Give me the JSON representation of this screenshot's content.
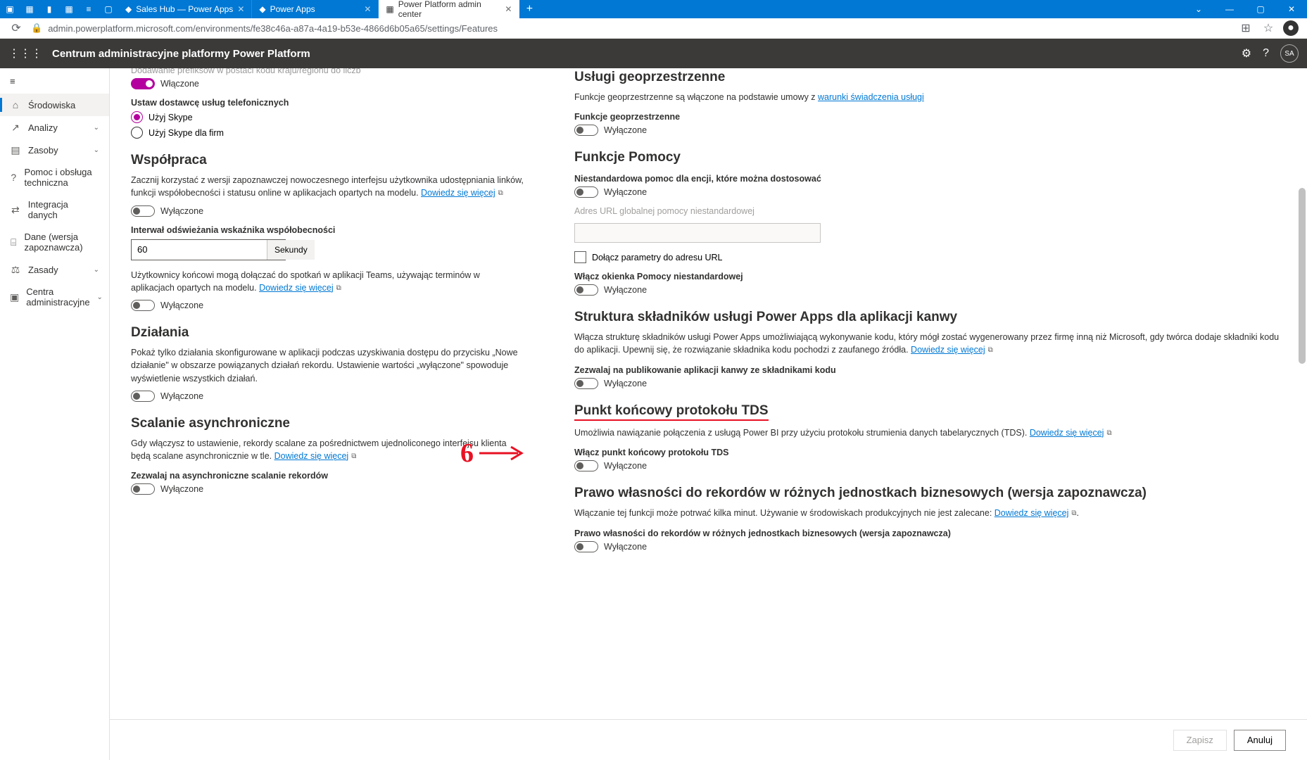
{
  "taskbar_apps": [
    "teams",
    "grid",
    "charts",
    "grid2",
    "list",
    "square"
  ],
  "browser": {
    "tabs": [
      {
        "icon": "◆",
        "label": "Sales Hub — Power Apps",
        "active": false
      },
      {
        "icon": "◆",
        "label": "Power Apps",
        "active": false
      },
      {
        "icon": "▦",
        "label": "Power Platform admin center",
        "active": true
      }
    ],
    "url": "admin.powerplatform.microsoft.com/environments/fe38c46a-a87a-4a19-b53e-4866d6b05a65/settings/Features"
  },
  "appbar": {
    "title": "Centrum administracyjne platformy Power Platform",
    "avatar": "SA"
  },
  "sidebar": {
    "items": [
      {
        "icon": "⌂",
        "label": "Środowiska",
        "active": true,
        "chev": false
      },
      {
        "icon": "↗",
        "label": "Analizy",
        "chev": true
      },
      {
        "icon": "▤",
        "label": "Zasoby",
        "chev": true
      },
      {
        "icon": "?",
        "label": "Pomoc i obsługa techniczna",
        "chev": false
      },
      {
        "icon": "⇄",
        "label": "Integracja danych",
        "chev": false
      },
      {
        "icon": "⌸",
        "label": "Dane (wersja zapoznawcza)",
        "chev": false
      },
      {
        "icon": "⚖",
        "label": "Zasady",
        "chev": true
      },
      {
        "icon": "▣",
        "label": "Centra administracyjne",
        "chev": true
      }
    ]
  },
  "left": {
    "truncated": "Dodawanie prefiksów w postaci kodu kraju/regionu do liczb",
    "enabled": "Włączone",
    "disabled": "Wyłączone",
    "telephony_lbl": "Ustaw dostawcę usług telefonicznych",
    "radio_skype": "Użyj Skype",
    "radio_skype_biz": "Użyj Skype dla firm",
    "collab_h": "Współpraca",
    "collab_desc": "Zacznij korzystać z wersji zapoznawczej nowoczesnego interfejsu użytkownika udostępniania linków, funkcji współobecności i statusu online w aplikacjach opartych na modelu. ",
    "learn": "Dowiedz się więcej",
    "interval_lbl": "Interwał odświeżania wskaźnika współobecności",
    "interval_val": "60",
    "interval_unit": "Sekundy",
    "teams_desc": "Użytkownicy końcowi mogą dołączać do spotkań w aplikacji Teams, używając terminów w aplikacjach opartych na modelu. ",
    "actions_h": "Działania",
    "actions_desc": "Pokaż tylko działania skonfigurowane w aplikacji podczas uzyskiwania dostępu do przycisku „Nowe działanie\" w obszarze powiązanych działań rekordu. Ustawienie wartości „wyłączone\" spowoduje wyświetlenie wszystkich działań.",
    "async_h": "Scalanie asynchroniczne",
    "async_desc": "Gdy włączysz to ustawienie, rekordy scalane za pośrednictwem ujednoliconego interfejsu klienta będą scalane asynchronicznie w tle. ",
    "async_lbl": "Zezwalaj na asynchroniczne scalanie rekordów"
  },
  "right": {
    "geo_h": "Usługi geoprzestrzenne",
    "geo_desc": "Funkcje geoprzestrzenne są włączone na podstawie umowy z ",
    "geo_link": "warunki świadczenia usługi",
    "geo_lbl": "Funkcje geoprzestrzenne",
    "help_h": "Funkcje Pomocy",
    "help_lbl1": "Niestandardowa pomoc dla encji, które można dostosować",
    "help_url_lbl": "Adres URL globalnej pomocy niestandardowej",
    "help_cb": "Dołącz parametry do adresu URL",
    "help_lbl2": "Włącz okienka Pomocy niestandardowej",
    "pcf_h": "Struktura składników usługi Power Apps dla aplikacji kanwy",
    "pcf_desc": "Włącza strukturę składników usługi Power Apps umożliwiającą wykonywanie kodu, który mógł zostać wygenerowany przez firmę inną niż Microsoft, gdy twórca dodaje składniki kodu do aplikacji. Upewnij się, że rozwiązanie składnika kodu pochodzi z zaufanego źródła. ",
    "pcf_lbl": "Zezwalaj na publikowanie aplikacji kanwy ze składnikami kodu",
    "tds_h": "Punkt końcowy protokołu TDS",
    "tds_desc": "Umożliwia nawiązanie połączenia z usługą Power BI przy użyciu protokołu strumienia danych tabelarycznych (TDS). ",
    "tds_lbl": "Włącz punkt końcowy protokołu TDS",
    "own_h": "Prawo własności do rekordów w różnych jednostkach biznesowych (wersja zapoznawcza)",
    "own_desc": "Włączanie tej funkcji może potrwać kilka minut. Używanie w środowiskach produkcyjnych nie jest zalecane: ",
    "own_lbl": "Prawo własności do rekordów w różnych jednostkach biznesowych (wersja zapoznawcza)"
  },
  "footer": {
    "save": "Zapisz",
    "cancel": "Anuluj"
  },
  "annotation": "6"
}
